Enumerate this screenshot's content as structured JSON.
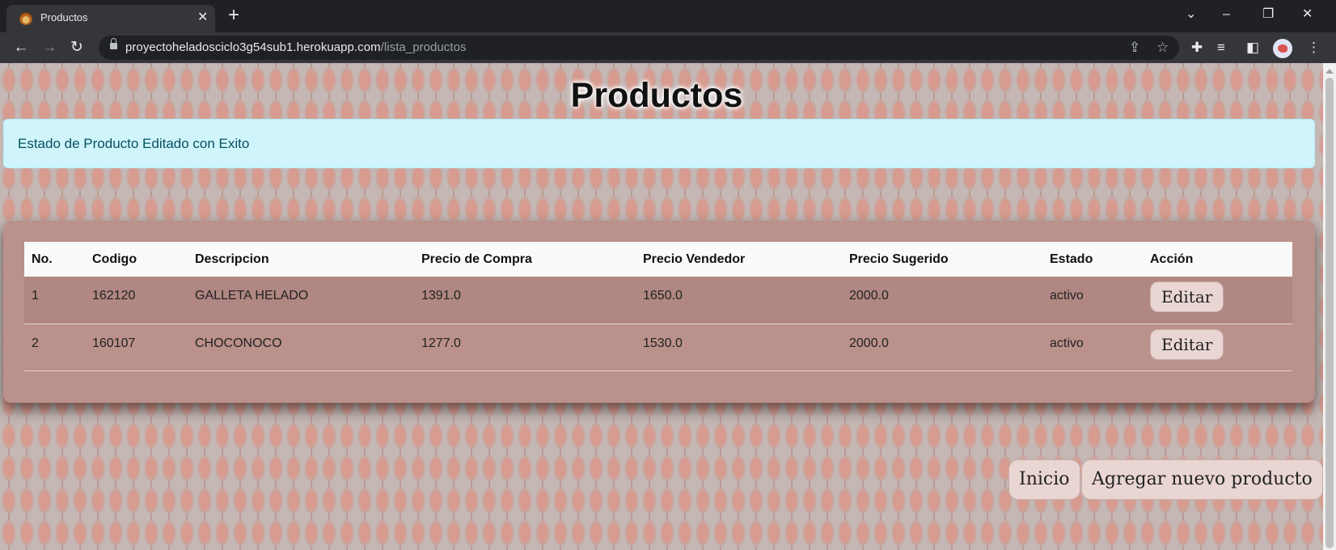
{
  "browser": {
    "tab_title": "Productos",
    "tab_close": "✕",
    "new_tab": "+",
    "url_host": "proyectoheladosciclo3g54sub1.herokuapp.com",
    "url_path": "/lista_productos",
    "icons": [
      "back-icon",
      "forward-icon",
      "reload-icon",
      "lock-icon",
      "share-icon",
      "star-icon",
      "extensions-icon",
      "media-icon",
      "side-panel-icon",
      "menu-icon"
    ]
  },
  "page": {
    "title": "Productos",
    "alert": "Estado de Producto Editado con Exito",
    "table": {
      "headers": [
        "No.",
        "Codigo",
        "Descripcion",
        "Precio de Compra",
        "Precio Vendedor",
        "Precio Sugerido",
        "Estado",
        "Acción"
      ],
      "rows": [
        [
          "1",
          "162120",
          "GALLETA HELADO",
          "1391.0",
          "1650.0",
          "2000.0",
          "activo"
        ],
        [
          "2",
          "160107",
          "CHOCONOCO",
          "1277.0",
          "1530.0",
          "2000.0",
          "activo"
        ]
      ],
      "edit_label": "Editar"
    },
    "buttons": {
      "home": "Inicio",
      "add": "Agregar nuevo producto"
    }
  }
}
